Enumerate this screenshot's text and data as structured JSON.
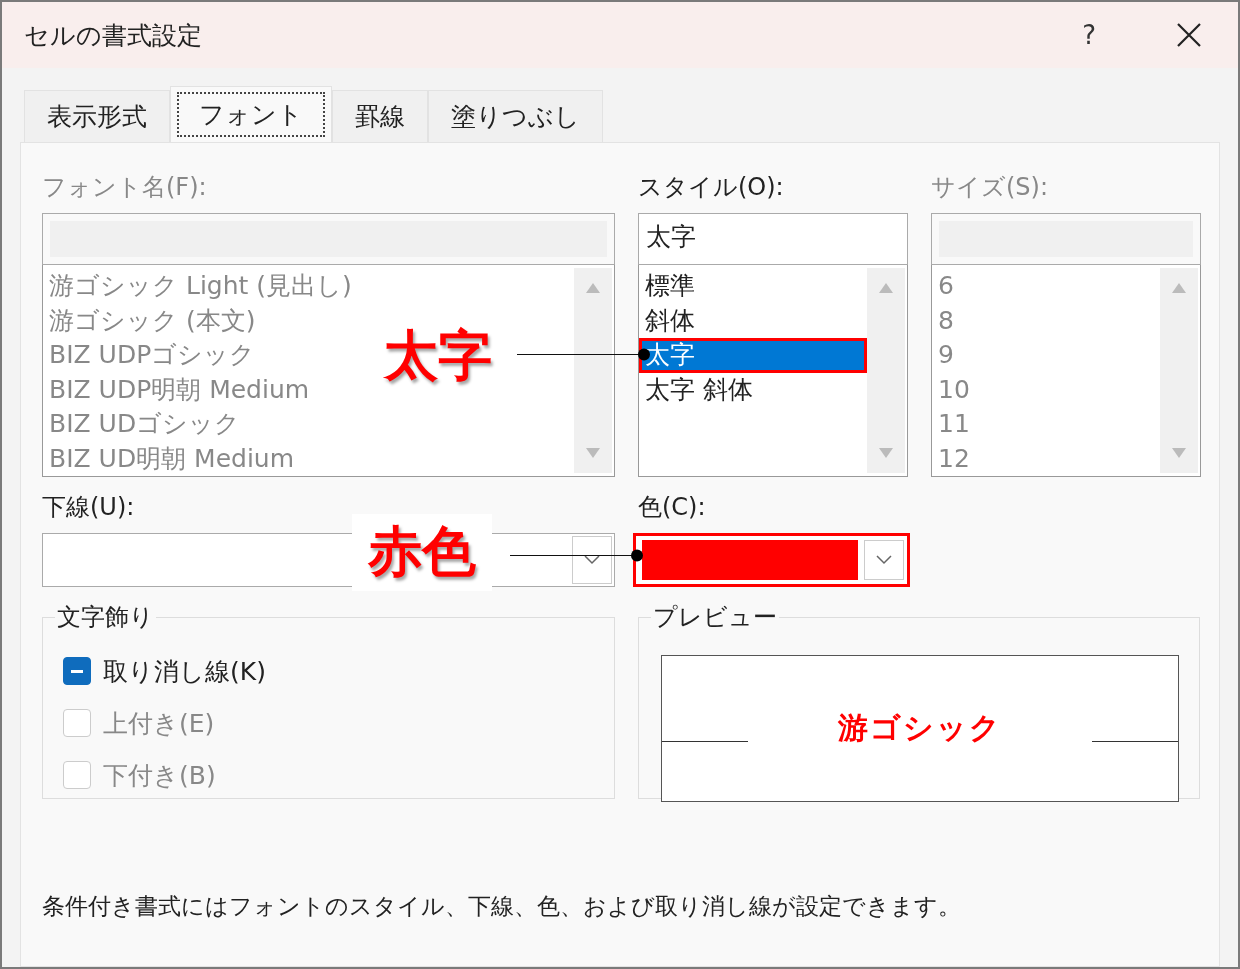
{
  "window": {
    "title": "セルの書式設定",
    "help": "?"
  },
  "tabs": [
    {
      "label": "表示形式",
      "selected": false
    },
    {
      "label": "フォント",
      "selected": true
    },
    {
      "label": "罫線",
      "selected": false
    },
    {
      "label": "塗りつぶし",
      "selected": false
    }
  ],
  "font_name": {
    "label": "フォント名(F):",
    "disabled": true,
    "items": [
      "游ゴシック Light (見出し)",
      "游ゴシック (本文)",
      "BIZ UDPゴシック",
      "BIZ UDP明朝 Medium",
      "BIZ UDゴシック",
      "BIZ UD明朝 Medium"
    ]
  },
  "style": {
    "label": "スタイル(O):",
    "value": "太字",
    "disabled": false,
    "items": [
      {
        "label": "標準",
        "selected": false,
        "highlighted": false
      },
      {
        "label": "斜体",
        "selected": false,
        "highlighted": false
      },
      {
        "label": "太字",
        "selected": true,
        "highlighted": true
      },
      {
        "label": "太字 斜体",
        "selected": false,
        "highlighted": false
      }
    ]
  },
  "size": {
    "label": "サイズ(S):",
    "disabled": true,
    "items": [
      "6",
      "8",
      "9",
      "10",
      "11",
      "12"
    ]
  },
  "underline": {
    "label": "下線(U):"
  },
  "color": {
    "label": "色(C):",
    "color": "#ff0000",
    "highlighted": true
  },
  "effects": {
    "title": "文字飾り",
    "options": [
      {
        "label": "取り消し線(K)",
        "indeterminate": true,
        "disabled": false
      },
      {
        "label": "上付き(E)",
        "indeterminate": false,
        "disabled": true
      },
      {
        "label": "下付き(B)",
        "indeterminate": false,
        "disabled": true
      }
    ]
  },
  "preview": {
    "title": "プレビュー",
    "sample": "游ゴシック",
    "color": "#ff0000"
  },
  "note": "条件付き書式にはフォントのスタイル、下線、色、および取り消し線が設定できます。",
  "annotations": [
    {
      "text": "太字"
    },
    {
      "text": "赤色"
    }
  ]
}
